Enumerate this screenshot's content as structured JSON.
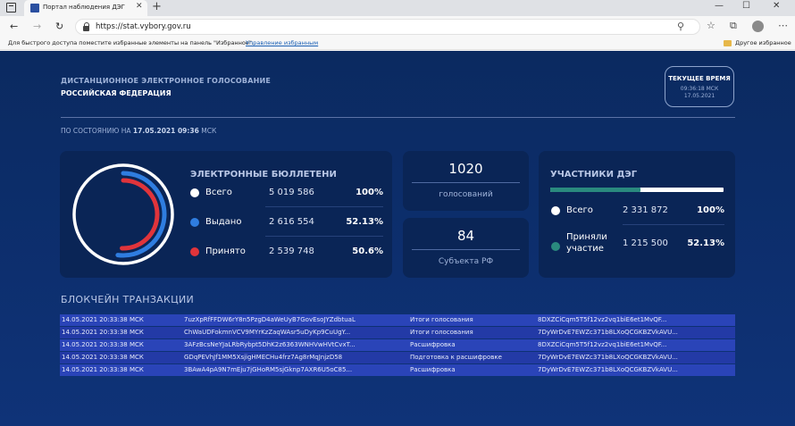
{
  "browser": {
    "tab_title": "Портал наблюдения ДЭГ",
    "url": "https://stat.vybory.gov.ru",
    "favorites_hint": "Для быстрого доступа поместите избранные элементы на панель \"Избранное\".",
    "favorites_manage_link": "Управление избранным",
    "other_favorites": "Другое избранное"
  },
  "header": {
    "subtitle": "ДИСТАНЦИОННОЕ ЭЛЕКТРОННОЕ ГОЛОСОВАНИЕ",
    "region": "РОССИЙСКАЯ ФЕДЕРАЦИЯ",
    "current_time_label": "ТЕКУЩЕЕ ВРЕМЯ",
    "current_time": "09:36:18 МСК",
    "current_date": "17.05.2021",
    "as_of_prefix": "ПО СОСТОЯНИЮ НА",
    "as_of_value": "17.05.2021 09:36",
    "as_of_suffix": "МСК"
  },
  "bulletins": {
    "title": "ЭЛЕКТРОННЫЕ БЮЛЛЕТЕНИ",
    "rows": [
      {
        "label": "Всего",
        "value": "5 019 586",
        "percent": "100%",
        "color": "#ffffff",
        "fraction": 1.0
      },
      {
        "label": "Выдано",
        "value": "2 616 554",
        "percent": "52.13%",
        "color": "#2f7de0",
        "fraction": 0.5213
      },
      {
        "label": "Принято",
        "value": "2 539 748",
        "percent": "50.6%",
        "color": "#e0343b",
        "fraction": 0.506
      }
    ]
  },
  "votes": {
    "number": "1020",
    "label": "голосований"
  },
  "regions": {
    "number": "84",
    "label": "Субъекта РФ"
  },
  "participants": {
    "title": "УЧАСТНИКИ ДЭГ",
    "progress": 0.5213,
    "rows": [
      {
        "label": "Всего",
        "value": "2 331 872",
        "percent": "100%",
        "color": "#ffffff"
      },
      {
        "label_line1": "Приняли",
        "label_line2": "участие",
        "value": "1 215 500",
        "percent": "52.13%",
        "color": "#2a8a7e"
      }
    ]
  },
  "blockchain": {
    "title": "БЛОКЧЕЙН ТРАНЗАКЦИИ",
    "rows": [
      {
        "time": "14.05.2021 20:33:38 МСК",
        "hash": "7uzXpRfFFDW6rY8n5PzgD4aWeUyB7GovEsoJYZdbtuaL",
        "type": "Итоги голосования",
        "sig": "8DXZCiCqm5T5f12vz2vq1biE6et1MvQF..."
      },
      {
        "time": "14.05.2021 20:33:38 МСК",
        "hash": "ChWaUDFokmnVCV9MYrKzZaqWAsr5uDyKp9CuUgY...",
        "type": "Итоги голосования",
        "sig": "7DyWrDvE7EWZc371b8LXoQCGKBZVkAVU..."
      },
      {
        "time": "14.05.2021 20:33:38 МСК",
        "hash": "3AFzBcsNeYJaLRbRybpt5DhK2z6363WNHVwHVtCvxT...",
        "type": "Расшифровка",
        "sig": "8DXZCiCqm5T5f12vz2vq1biE6et1MvQF..."
      },
      {
        "time": "14.05.2021 20:33:38 МСК",
        "hash": "GDqPEVhJf1MM5XsjigHMECHu4frz7Ag8rMqJnjzD58",
        "type": "Подготовка к расшифровке",
        "sig": "7DyWrDvE7EWZc371b8LXoQCGKBZVkAVU..."
      },
      {
        "time": "14.05.2021 20:33:38 МСК",
        "hash": "3BAwA4pA9N7mEju7jGHoRM5sjGknp7AXR6U5oC85...",
        "type": "Расшифровка",
        "sig": "7DyWrDvE7EWZc371b8LXoQCGKBZVkAVU..."
      }
    ]
  }
}
